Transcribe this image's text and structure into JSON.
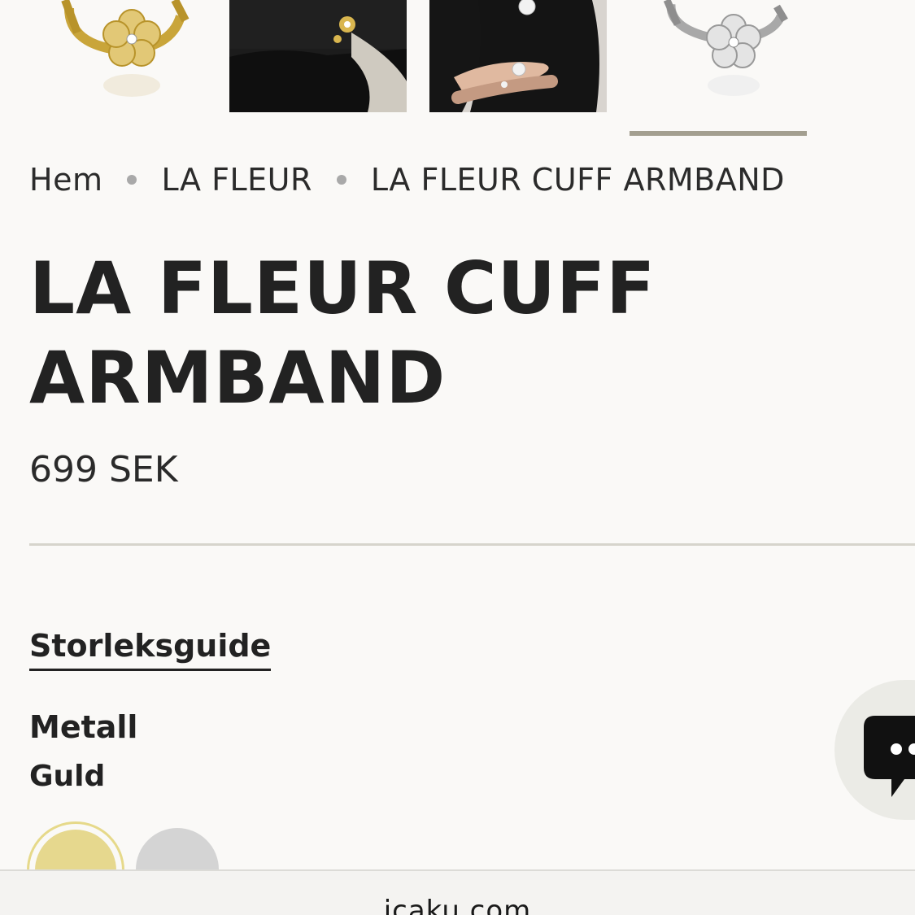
{
  "gallery": {
    "thumbnails": [
      {
        "alt_icon": "gold-cuff-icon"
      },
      {
        "alt_icon": "photo-icon"
      },
      {
        "alt_icon": "photo-icon"
      },
      {
        "alt_icon": "silver-cuff-icon"
      }
    ],
    "active_index": 3
  },
  "breadcrumb": {
    "items": [
      "Hem",
      "LA FLEUR",
      "LA FLEUR CUFF ARMBAND"
    ]
  },
  "product": {
    "title": "LA FLEUR CUFF ARMBAND",
    "price": "699 SEK"
  },
  "size_guide": {
    "label": "Storleksguide"
  },
  "options": {
    "metal_label": "Metall",
    "metal_value": "Guld",
    "swatches": [
      {
        "name": "Guld",
        "color": "#e6d88e",
        "selected": true
      },
      {
        "name": "Silver",
        "color": "#d4d4d4",
        "selected": false
      }
    ]
  },
  "chat": {
    "icon": "chat-icon"
  },
  "browser": {
    "url": "icaku.com"
  },
  "colors": {
    "background": "#faf9f7",
    "text": "#1f1f1f",
    "indicator": "#a39f90",
    "gold": "#e6d88e",
    "silver": "#d4d4d4"
  }
}
